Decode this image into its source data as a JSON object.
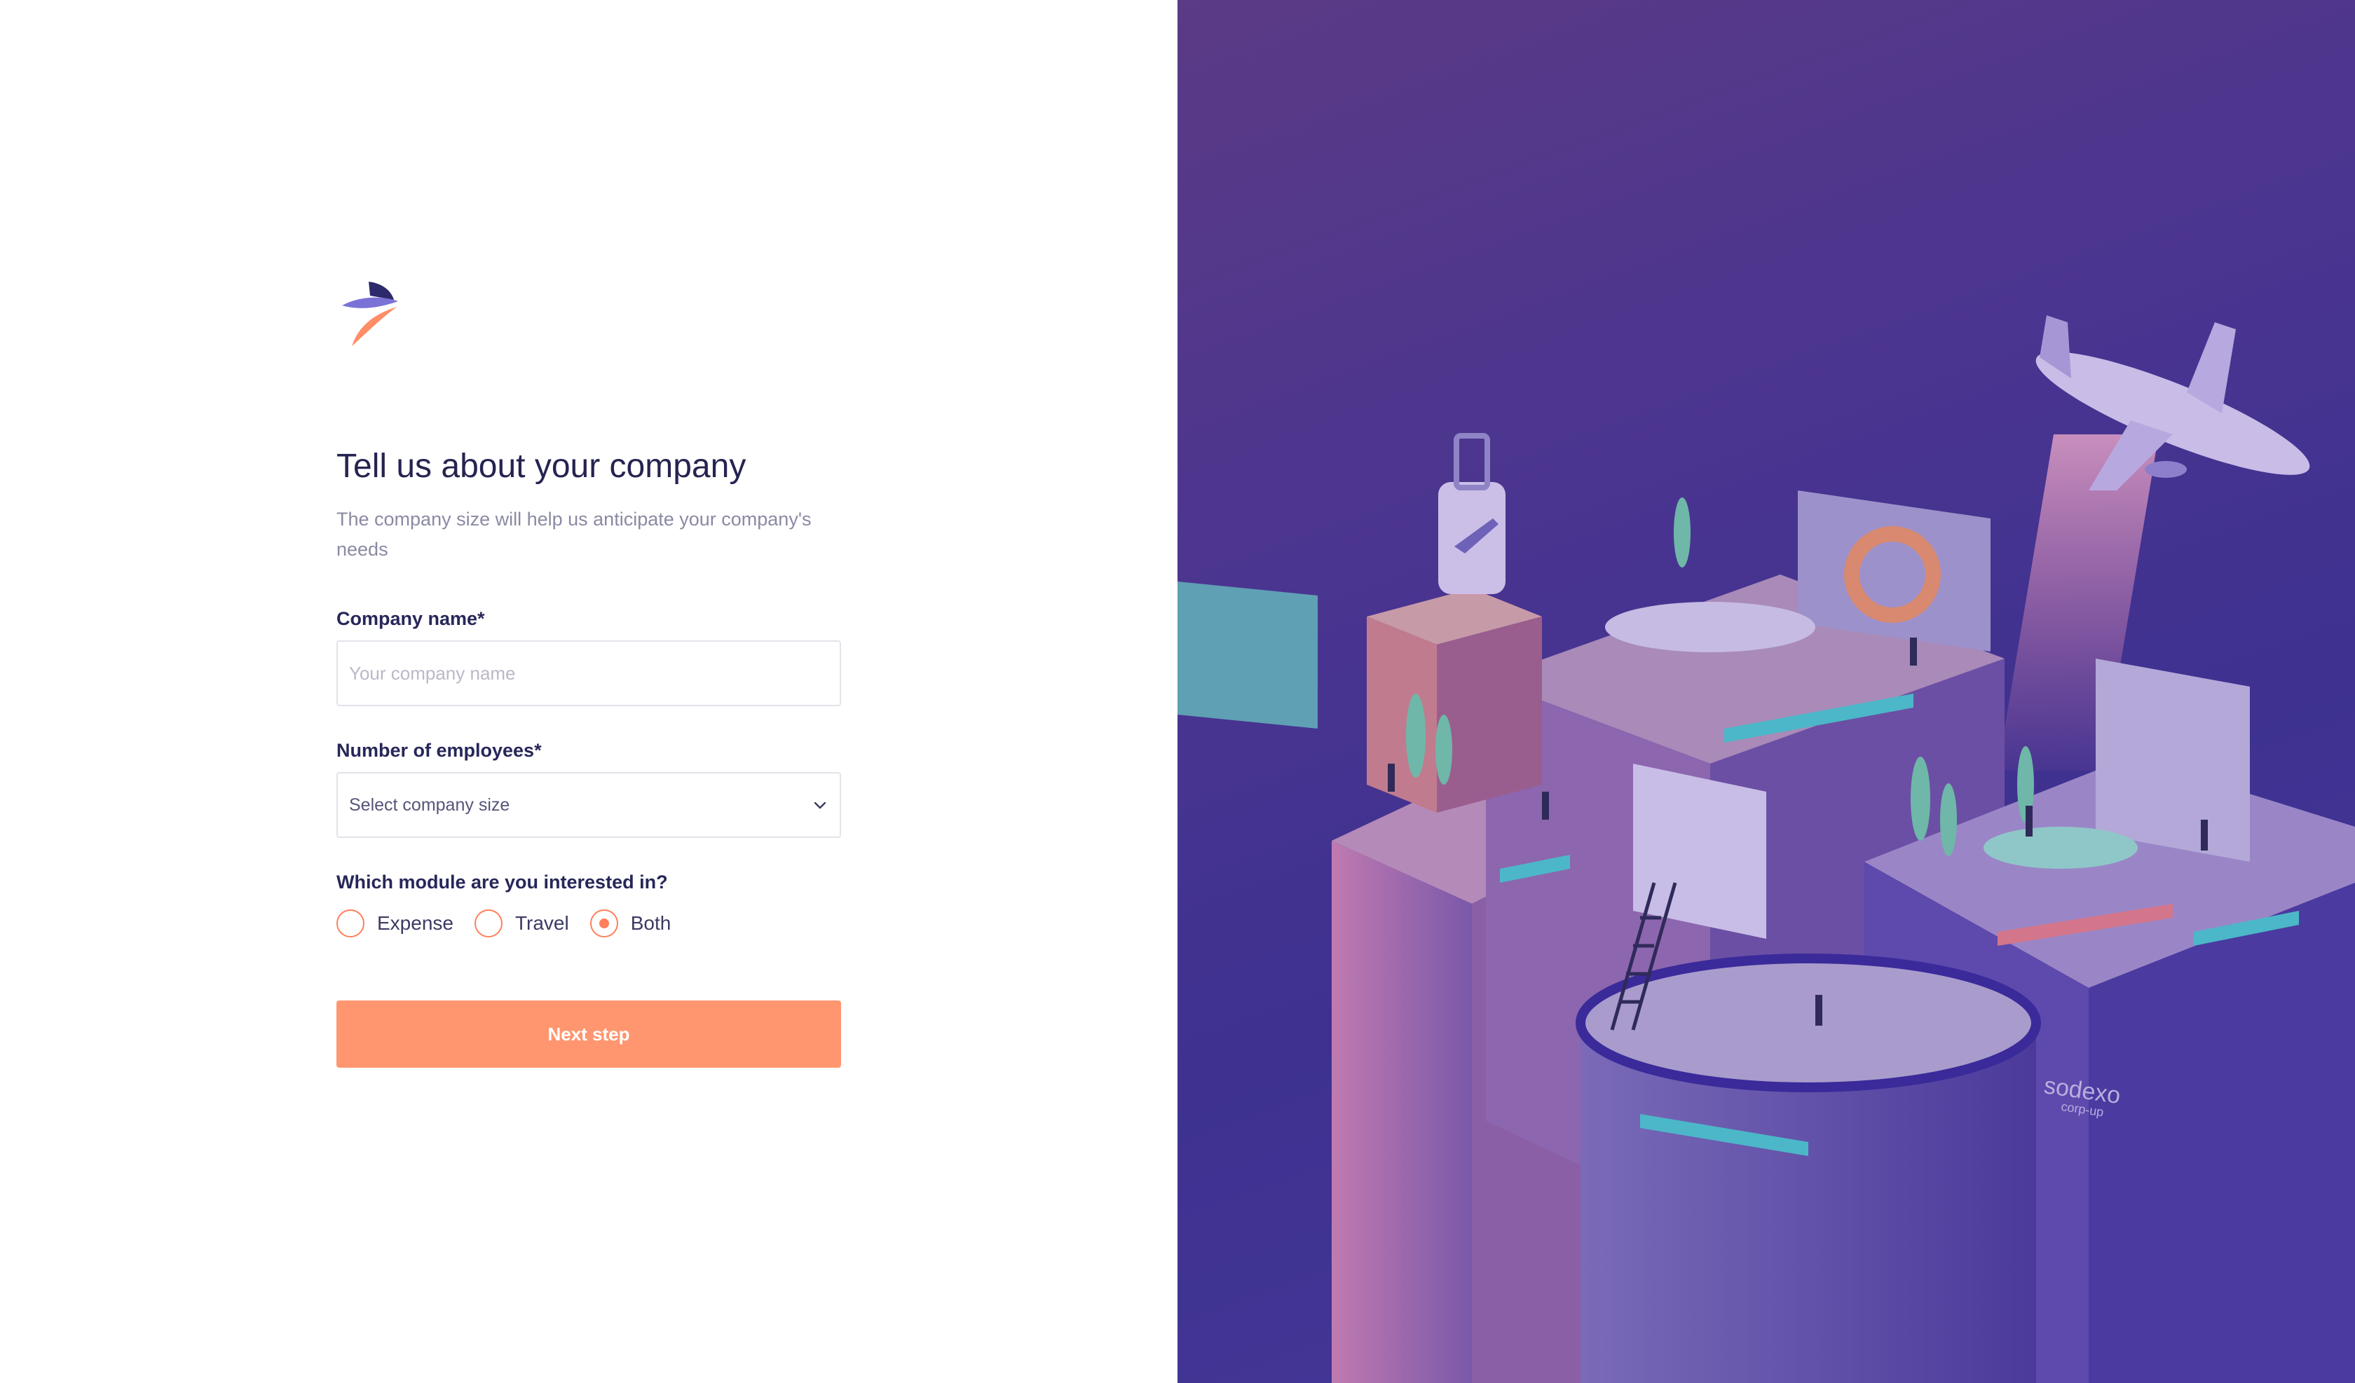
{
  "form": {
    "title": "Tell us about your company",
    "subtitle": "The company size will help us anticipate your company's needs",
    "company_name": {
      "label": "Company name*",
      "placeholder": "Your company name",
      "value": ""
    },
    "employees": {
      "label": "Number of employees*",
      "selected": "Select company size"
    },
    "module": {
      "label": "Which module are you interested in?",
      "options": [
        {
          "label": "Expense",
          "checked": false
        },
        {
          "label": "Travel",
          "checked": false
        },
        {
          "label": "Both",
          "checked": true
        }
      ]
    },
    "next_label": "Next step"
  },
  "illustration": {
    "watermark": "sodexo corp-up"
  },
  "colors": {
    "accent": "#ff9670",
    "radio": "#ff7f5c",
    "title": "#252450",
    "panel": "#4a3590"
  }
}
